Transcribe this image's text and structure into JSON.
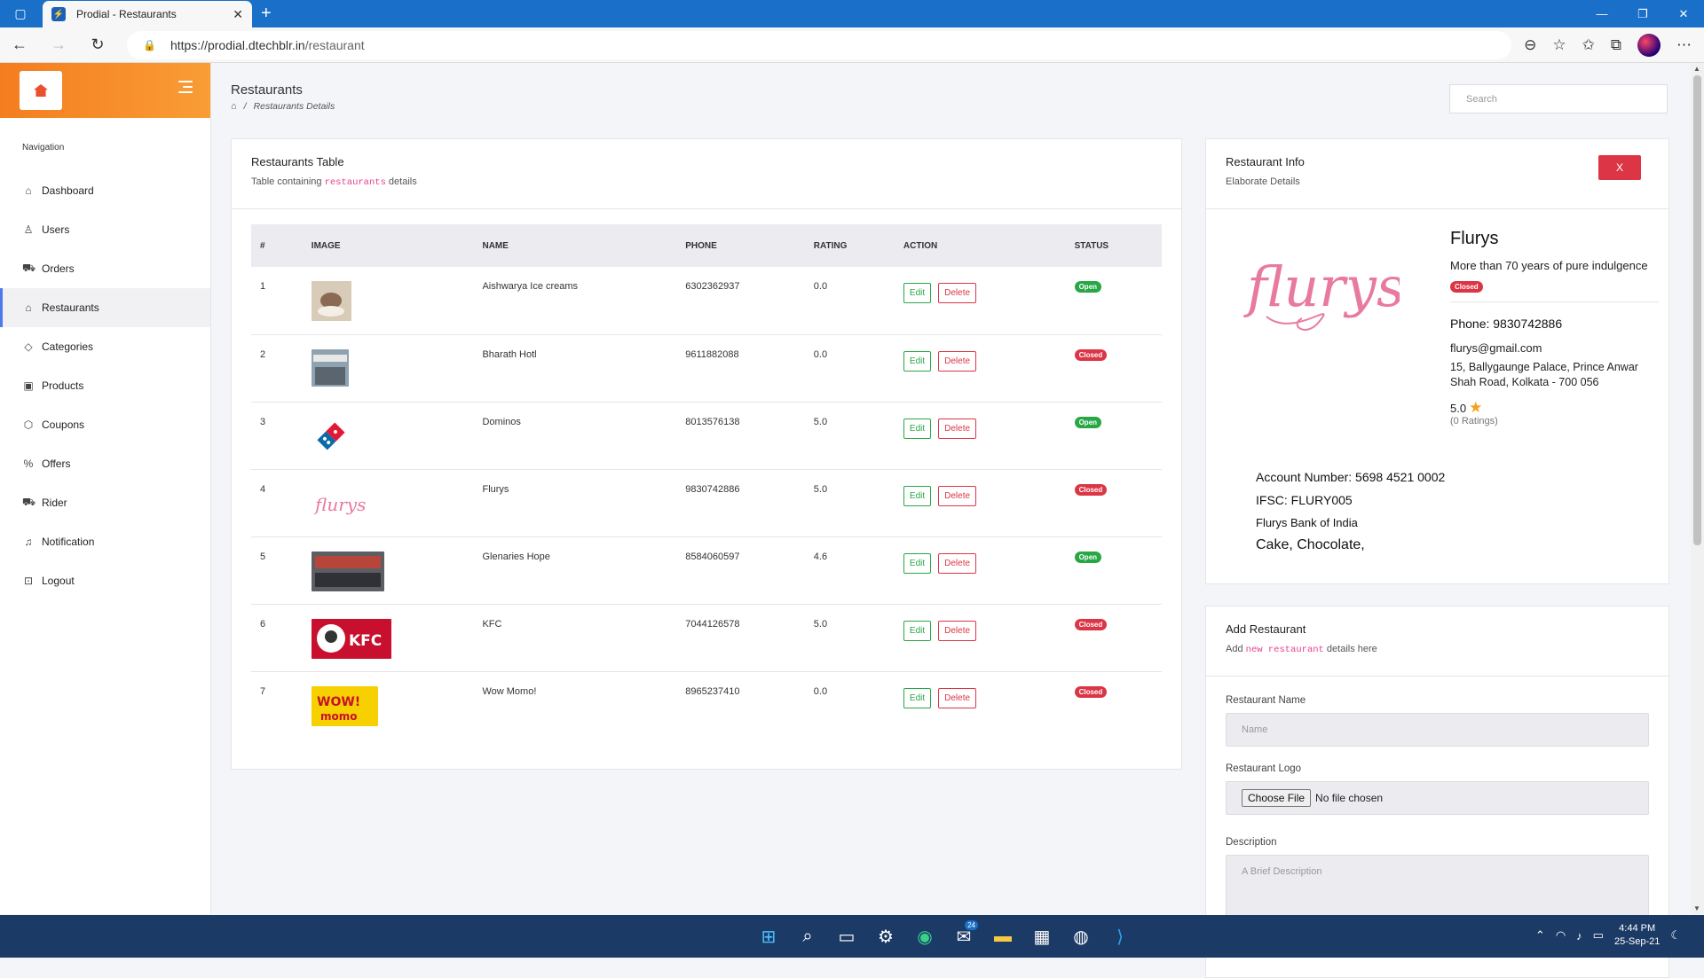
{
  "browser": {
    "tab_title": "Prodial - Restaurants",
    "url_host": "https://prodial.dtechblr.in",
    "url_path": "/restaurant"
  },
  "sidebar": {
    "nav_label": "Navigation",
    "items": [
      {
        "label": "Dashboard",
        "icon": "home-icon",
        "glyph": "⌂"
      },
      {
        "label": "Users",
        "icon": "user-icon",
        "glyph": "♙"
      },
      {
        "label": "Orders",
        "icon": "cart-icon",
        "glyph": "⛟"
      },
      {
        "label": "Restaurants",
        "icon": "home-icon",
        "glyph": "⌂",
        "active": true
      },
      {
        "label": "Categories",
        "icon": "tag-icon",
        "glyph": "◇"
      },
      {
        "label": "Products",
        "icon": "briefcase-icon",
        "glyph": "▣"
      },
      {
        "label": "Coupons",
        "icon": "box-icon",
        "glyph": "⬡"
      },
      {
        "label": "Offers",
        "icon": "percent-icon",
        "glyph": "%"
      },
      {
        "label": "Rider",
        "icon": "cart-icon",
        "glyph": "⛟"
      },
      {
        "label": "Notification",
        "icon": "bell-icon",
        "glyph": "♫"
      },
      {
        "label": "Logout",
        "icon": "lock-icon",
        "glyph": "⊡"
      }
    ]
  },
  "header": {
    "title": "Restaurants",
    "breadcrumb": "Restaurants Details",
    "search_placeholder": "Search"
  },
  "table": {
    "title": "Restaurants Table",
    "sub_before": "Table containing ",
    "sub_code": "restaurants",
    "sub_after": " details",
    "columns": [
      "#",
      "IMAGE",
      "NAME",
      "PHONE",
      "RATING",
      "ACTION",
      "STATUS"
    ],
    "edit_label": "Edit",
    "delete_label": "Delete",
    "rows": [
      {
        "num": "1",
        "name": "Aishwarya Ice creams",
        "phone": "6302362937",
        "rating": "0.0",
        "status": "Open",
        "img": "ice"
      },
      {
        "num": "2",
        "name": "Bharath Hotl",
        "phone": "9611882088",
        "rating": "0.0",
        "status": "Closed",
        "img": "hotel"
      },
      {
        "num": "3",
        "name": "Dominos",
        "phone": "8013576138",
        "rating": "5.0",
        "status": "Open",
        "img": "dominos"
      },
      {
        "num": "4",
        "name": "Flurys",
        "phone": "9830742886",
        "rating": "5.0",
        "status": "Closed",
        "img": "flurys"
      },
      {
        "num": "5",
        "name": "Glenaries Hope",
        "phone": "8584060597",
        "rating": "4.6",
        "status": "Open",
        "img": "glen"
      },
      {
        "num": "6",
        "name": "KFC",
        "phone": "7044126578",
        "rating": "5.0",
        "status": "Closed",
        "img": "kfc"
      },
      {
        "num": "7",
        "name": "Wow Momo!",
        "phone": "8965237410",
        "rating": "0.0",
        "status": "Closed",
        "img": "wow"
      }
    ]
  },
  "info": {
    "title": "Restaurant Info",
    "subtitle": "Elaborate Details",
    "close_label": "X",
    "logo_text": "flurys",
    "name": "Flurys",
    "tagline": "More than 70 years of pure indulgence",
    "status": "Closed",
    "phone": "Phone: 9830742886",
    "email": "flurys@gmail.com",
    "address": "15, Ballygaunge Palace, Prince Anwar Shah Road, Kolkata - 700 056",
    "rating": "5.0",
    "rating_count": "(0 Ratings)",
    "account": "Account Number: 5698 4521 0002",
    "ifsc": "IFSC: FLURY005",
    "bank": "Flurys Bank of India",
    "categories": "Cake, Chocolate,"
  },
  "add": {
    "title": "Add Restaurant",
    "sub_before": "Add ",
    "sub_code": "new restaurant",
    "sub_after": " details here",
    "name_label": "Restaurant Name",
    "name_placeholder": "Name",
    "logo_label": "Restaurant Logo",
    "file_button": "Choose File",
    "file_text": "No file chosen",
    "desc_label": "Description",
    "desc_placeholder": "A Brief Description"
  },
  "taskbar": {
    "time": "4:44 PM",
    "date": "25-Sep-21",
    "mail_count": "24"
  },
  "colors": {
    "accent_orange": "#f47d1f",
    "open_green": "#28a745",
    "closed_red": "#dc3545",
    "code_pink": "#e83e8c"
  }
}
